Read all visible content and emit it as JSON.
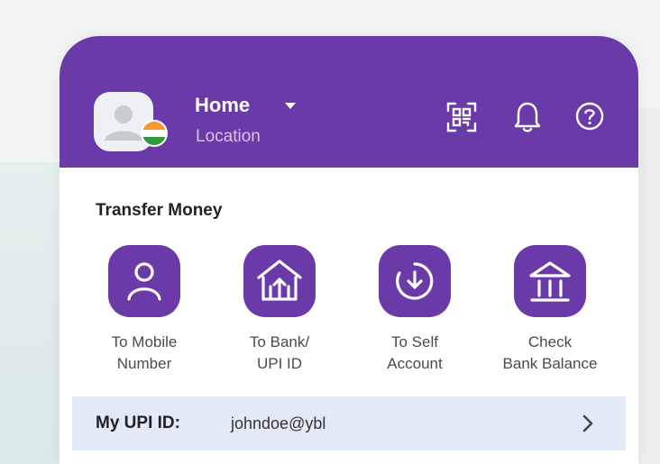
{
  "theme": {
    "brand": "#6a3aa8",
    "tile": "#6b3aa9",
    "upi_bar": "#e3eaf7"
  },
  "header": {
    "location_title": "Home",
    "location_subtitle": "Location",
    "avatar_icon": "user-avatar-icon",
    "flag_icon": "india-flag-icon",
    "actions": [
      {
        "icon": "qr-scan-icon"
      },
      {
        "icon": "bell-icon"
      },
      {
        "icon": "help-icon"
      }
    ]
  },
  "transfer": {
    "title": "Transfer Money",
    "actions": [
      {
        "icon": "person-icon",
        "line1": "To Mobile",
        "line2": "Number"
      },
      {
        "icon": "bank-upi-icon",
        "line1": "To Bank/",
        "line2": "UPI ID"
      },
      {
        "icon": "self-transfer-icon",
        "line1": "To Self",
        "line2": "Account"
      },
      {
        "icon": "bank-icon",
        "line1": "Check",
        "line2": "Bank Balance"
      }
    ]
  },
  "upi": {
    "label": "My UPI ID:",
    "value": "johndoe@ybl"
  }
}
